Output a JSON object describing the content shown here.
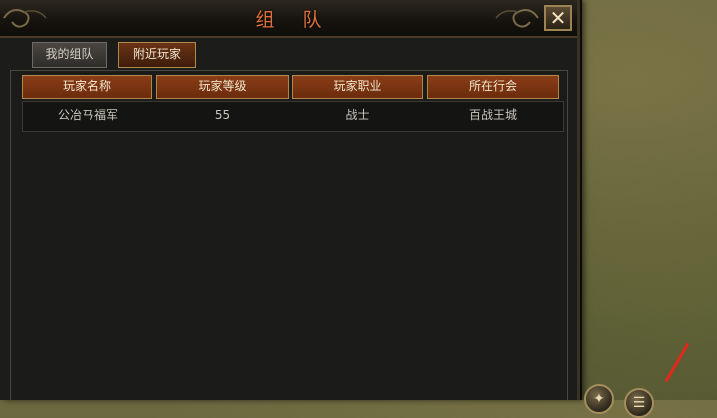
{
  "window": {
    "title": "组队",
    "close_label": "✕"
  },
  "tabs": [
    {
      "label": "我的组队",
      "active": false
    },
    {
      "label": "附近玩家",
      "active": true
    }
  ],
  "table": {
    "headers": [
      "玩家名称",
      "玩家等级",
      "玩家职业",
      "所在行会"
    ],
    "rows": [
      {
        "name": "公冶ㄢ福军",
        "level": "55",
        "class": "战士",
        "guild": "百战王城"
      }
    ]
  },
  "icons": {
    "close": "close-icon",
    "corner_ornament": "ornament-icon",
    "bottom_buttons": [
      "skill-icon",
      "round-menu-icon"
    ],
    "pointer": "red-arrow-icon"
  },
  "colors": {
    "title": "#e0703a",
    "header_bg": "#7a3410",
    "panel_bg": "#1c1c1a",
    "active_tab_bg": "#5a2a11"
  }
}
